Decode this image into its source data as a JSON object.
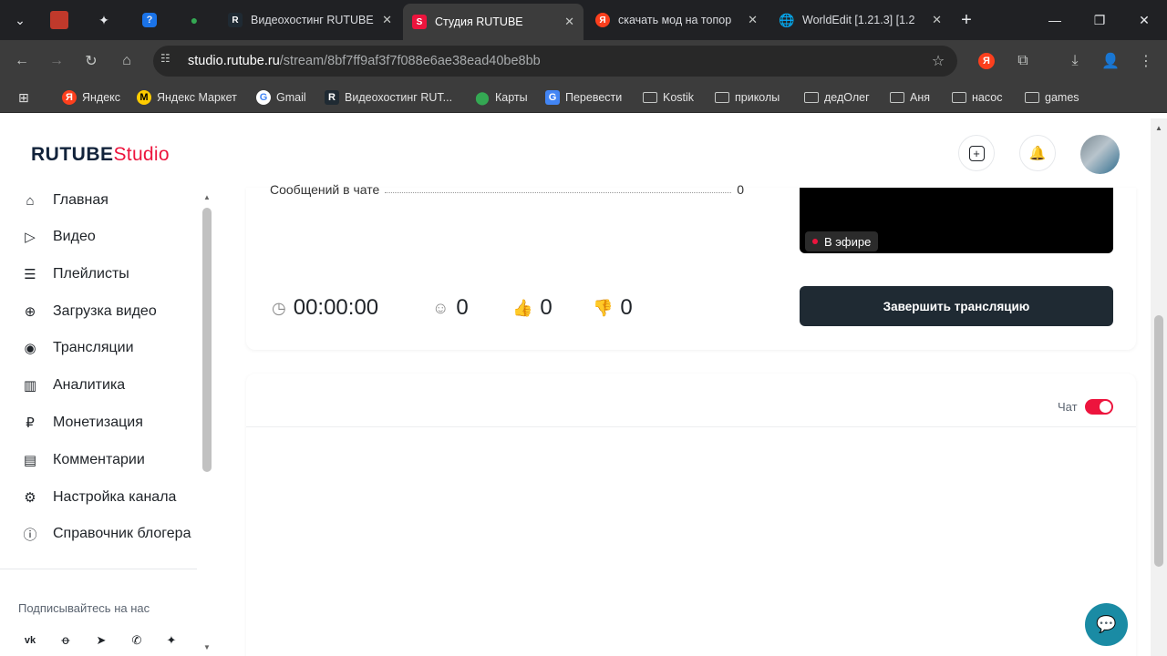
{
  "browser": {
    "tabs": [
      {
        "title": "Видеохостинг RUTUBE",
        "favicon": "rutube-icon"
      },
      {
        "title": "Студия RUTUBE",
        "favicon": "rutube-studio-icon",
        "active": true
      },
      {
        "title": "скачать мод на топор",
        "favicon": "yandex-icon"
      },
      {
        "title": "WorldEdit [1.21.3] [1.2",
        "favicon": "globe-icon"
      }
    ],
    "url_host": "studio.rutube.ru",
    "url_path": "/stream/8bf7ff9af3f7f088e6ae38ead40be8bb",
    "bookmarks": [
      "Яндекс",
      "Яндекс Маркет",
      "Gmail",
      "Видеохостинг RUT...",
      "Карты",
      "Перевести",
      "Kostik",
      "приколы",
      "дедОлег",
      "Аня",
      "насос",
      "games"
    ]
  },
  "header": {
    "logo_main": "RUTUBE",
    "logo_sub": "Studio"
  },
  "sidebar": {
    "items": [
      {
        "label": "Главная",
        "icon": "home-icon"
      },
      {
        "label": "Видео",
        "icon": "video-icon"
      },
      {
        "label": "Плейлисты",
        "icon": "playlist-icon"
      },
      {
        "label": "Загрузка видео",
        "icon": "upload-icon"
      },
      {
        "label": "Трансляции",
        "icon": "broadcast-icon"
      },
      {
        "label": "Аналитика",
        "icon": "analytics-icon"
      },
      {
        "label": "Монетизация",
        "icon": "ruble-icon"
      },
      {
        "label": "Комментарии",
        "icon": "comments-icon"
      },
      {
        "label": "Настройка канала",
        "icon": "settings-icon"
      },
      {
        "label": "Справочник блогера",
        "icon": "info-icon"
      }
    ],
    "subscribe_label": "Подписывайтесь на нас"
  },
  "stream": {
    "chat_messages_label": "Сообщений в чате",
    "chat_messages_value": "0",
    "live_badge": "В эфире",
    "end_button": "Завершить трансляцию",
    "duration": "00:00:00",
    "viewers": "0",
    "likes": "0",
    "dislikes": "0",
    "chat_toggle_label": "Чат",
    "chat_enabled": true
  },
  "colors": {
    "brand": "#ed143d",
    "dark_button": "#1f2a33",
    "help_button": "#1a8ba4"
  }
}
